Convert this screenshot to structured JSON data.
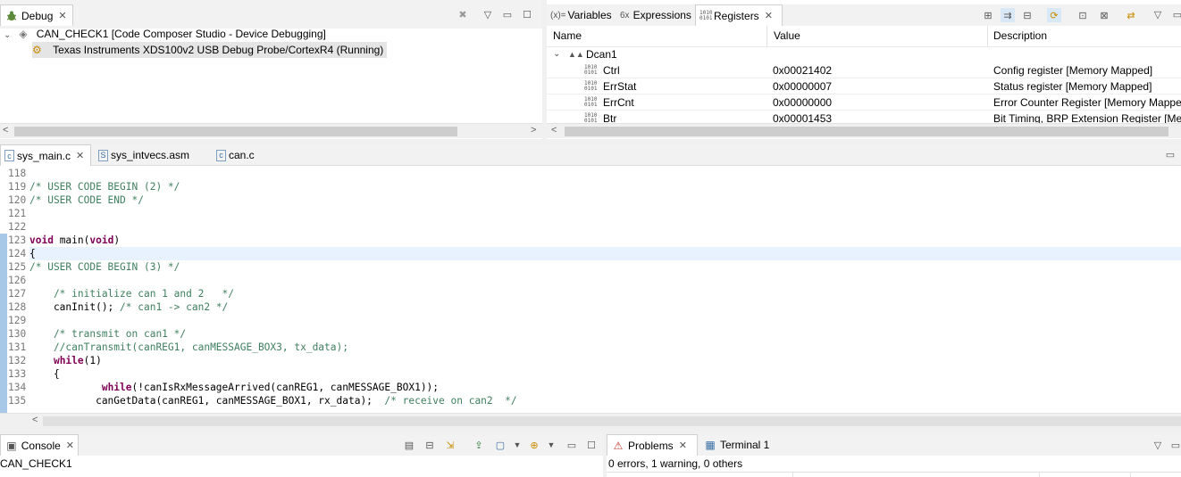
{
  "debug_view": {
    "tab_label": "Debug",
    "session": "CAN_CHECK1 [Code Composer Studio - Device Debugging]",
    "target": "Texas Instruments XDS100v2 USB Debug Probe/CortexR4 (Running)"
  },
  "vars_view": {
    "tabs": [
      {
        "label": "Variables",
        "icon_text": "(x)="
      },
      {
        "label": "Expressions",
        "icon_text": "6x"
      },
      {
        "label": "Registers",
        "icon_text": "1010"
      }
    ],
    "columns": [
      "Name",
      "Value",
      "Description"
    ],
    "group": "Dcan1",
    "rows": [
      {
        "name": "Ctrl",
        "value": "0x00021402",
        "desc": "Config register [Memory Mapped]"
      },
      {
        "name": "ErrStat",
        "value": "0x00000007",
        "desc": "Status register [Memory Mapped]"
      },
      {
        "name": "ErrCnt",
        "value": "0x00000000",
        "desc": "Error Counter Register [Memory Mapped]"
      },
      {
        "name": "Btr",
        "value": "0x00001453",
        "desc": "Bit Timing, BRP Extension Register [Memory Mapped]"
      }
    ]
  },
  "editor": {
    "tabs": [
      {
        "label": "sys_main.c",
        "icon": "c"
      },
      {
        "label": "sys_intvecs.asm",
        "icon": "S"
      },
      {
        "label": "can.c",
        "icon": "c"
      }
    ],
    "lines": [
      {
        "n": "118",
        "t": ""
      },
      {
        "n": "119",
        "t": "/* USER CODE BEGIN (2) */"
      },
      {
        "n": "120",
        "t": "/* USER CODE END */"
      },
      {
        "n": "121",
        "t": ""
      },
      {
        "n": "122",
        "t": ""
      },
      {
        "n": "123",
        "t": "void main(void)"
      },
      {
        "n": "124",
        "t": "{"
      },
      {
        "n": "125",
        "t": "/* USER CODE BEGIN (3) */"
      },
      {
        "n": "126",
        "t": ""
      },
      {
        "n": "127",
        "t": "    /* initialize can 1 and 2   */"
      },
      {
        "n": "128",
        "t": "    canInit(); /* can1 -> can2 */"
      },
      {
        "n": "129",
        "t": ""
      },
      {
        "n": "130",
        "t": "    /* transmit on can1 */"
      },
      {
        "n": "131",
        "t": "    //canTransmit(canREG1, canMESSAGE_BOX3, tx_data);"
      },
      {
        "n": "132",
        "t": "    while(1)"
      },
      {
        "n": "133",
        "t": "    {"
      },
      {
        "n": "134",
        "t": "            while(!canIsRxMessageArrived(canREG1, canMESSAGE_BOX1));"
      },
      {
        "n": "135",
        "t": "           canGetData(canREG1, canMESSAGE_BOX1, rx_data);  /* receive on can2  */"
      }
    ]
  },
  "console_view": {
    "tab_label": "Console",
    "title": "CAN_CHECK1"
  },
  "problems_view": {
    "tab_label": "Problems",
    "terminal_label": "Terminal 1",
    "summary": "0 errors, 1 warning, 0 others"
  },
  "colors": {
    "current_line": "#e8f2fe",
    "comment": "#3f7f5f",
    "keyword": "#7f0055",
    "selection": "#e5e5e5"
  }
}
